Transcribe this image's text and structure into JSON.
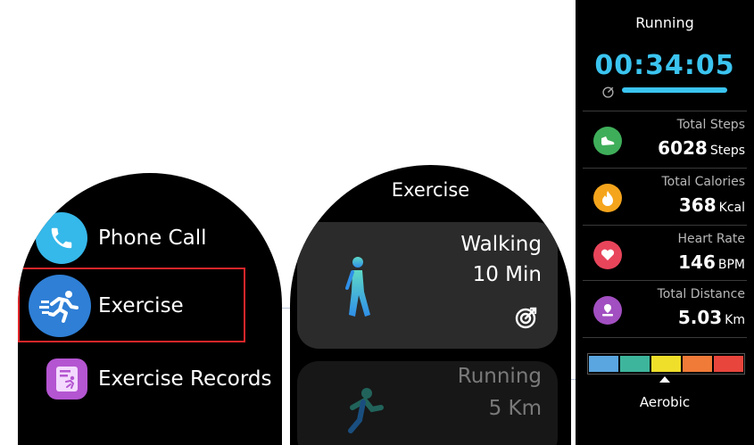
{
  "menu": {
    "items": [
      {
        "label": "Phone Call",
        "icon": "phone-icon",
        "color": "#35b8ea"
      },
      {
        "label": "Exercise",
        "icon": "running-person-icon",
        "color": "#2f7fd6"
      },
      {
        "label": "Exercise Records",
        "icon": "records-icon",
        "color": "#b455d1"
      }
    ],
    "highlight_color": "#e0262a"
  },
  "exercise_list": {
    "title": "Exercise",
    "cards": [
      {
        "name": "Walking",
        "goal": "10 Min",
        "icon": "walking-figure-icon"
      },
      {
        "name": "Running",
        "goal": "5 Km",
        "icon": "running-figure-icon"
      }
    ]
  },
  "workout": {
    "title": "Running",
    "timer": "00:34:05",
    "timer_color": "#3bc4f0",
    "stats": [
      {
        "label": "Total Steps",
        "value": "6028",
        "unit": "Steps",
        "icon": "shoe-icon",
        "color": "#3fae5a"
      },
      {
        "label": "Total Calories",
        "value": "368",
        "unit": "Kcal",
        "icon": "flame-icon",
        "color": "#f5a51c"
      },
      {
        "label": "Heart Rate",
        "value": "146",
        "unit": "BPM",
        "icon": "heart-icon",
        "color": "#e8455b"
      },
      {
        "label": "Total Distance",
        "value": "5.03",
        "unit": "Km",
        "icon": "distance-icon",
        "color": "#a24fc1"
      }
    ],
    "zones": [
      "#5aa6e0",
      "#3db59c",
      "#f0df2a",
      "#f07a38",
      "#e8453c"
    ],
    "zone_label": "Aerobic"
  }
}
